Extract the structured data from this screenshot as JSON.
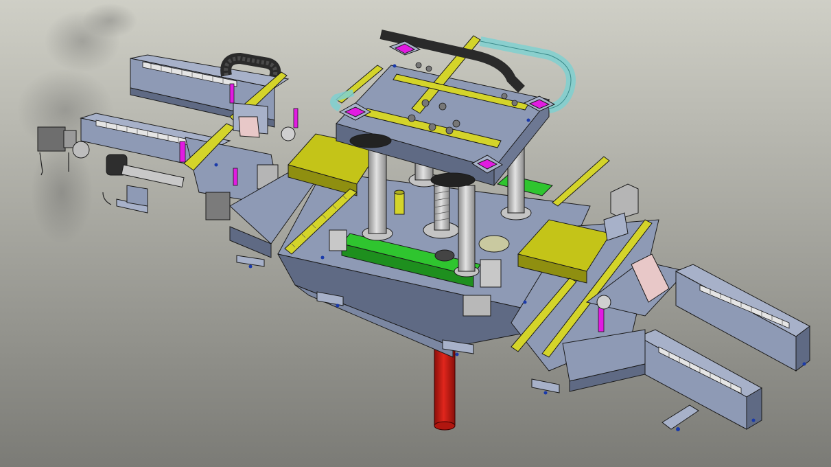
{
  "viewport": {
    "background_top": "#cfcfc6",
    "background_bottom": "#7b7b76",
    "view_mode": "shaded-with-edges"
  },
  "model": {
    "type": "3d-assembly",
    "part_colors": {
      "frame": "#8e9ab5",
      "frame_light": "#a7b1c9",
      "frame_dark": "#5f6a84",
      "plate_yellow": "#c4c418",
      "plate_yellow_dark": "#8f8f10",
      "rail_yellow": "#d4d42a",
      "rail_green": "#2fc52f",
      "pad_magenta": "#e11be1",
      "column_gray": "#c4c4c4",
      "column_red": "#cc1b12",
      "cable_chain_dark": "#2a2a2a",
      "cable_chain_clear": "#7fd0d0",
      "bracket_pink": "#e8c8c8",
      "edge_line": "#1a1a1a"
    },
    "icons": [
      "hidden-line-edges",
      "screw-icon",
      "bearing-icon"
    ]
  }
}
